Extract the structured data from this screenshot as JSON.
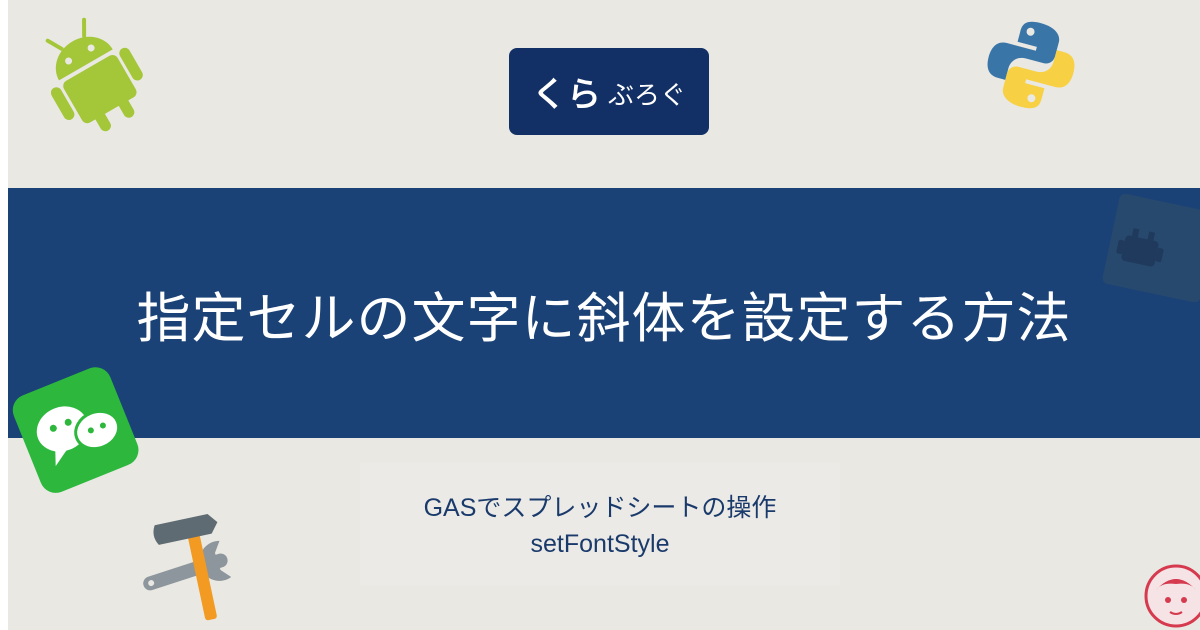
{
  "logo": {
    "part1": "くら",
    "part2": "ぶろぐ"
  },
  "banner": {
    "title": "指定セルの文字に斜体を設定する方法"
  },
  "subtitle": {
    "line1": "GASでスプレッドシートの操作",
    "line2": "setFontStyle"
  },
  "colors": {
    "background": "#e9e8e2",
    "banner": "#1a4276",
    "logo_bg": "#133066",
    "subtitle_text": "#1a3a6b"
  },
  "icons": [
    "android-icon",
    "python-icon",
    "chat-icon",
    "tools-icon",
    "robot-icon",
    "avatar-icon"
  ]
}
